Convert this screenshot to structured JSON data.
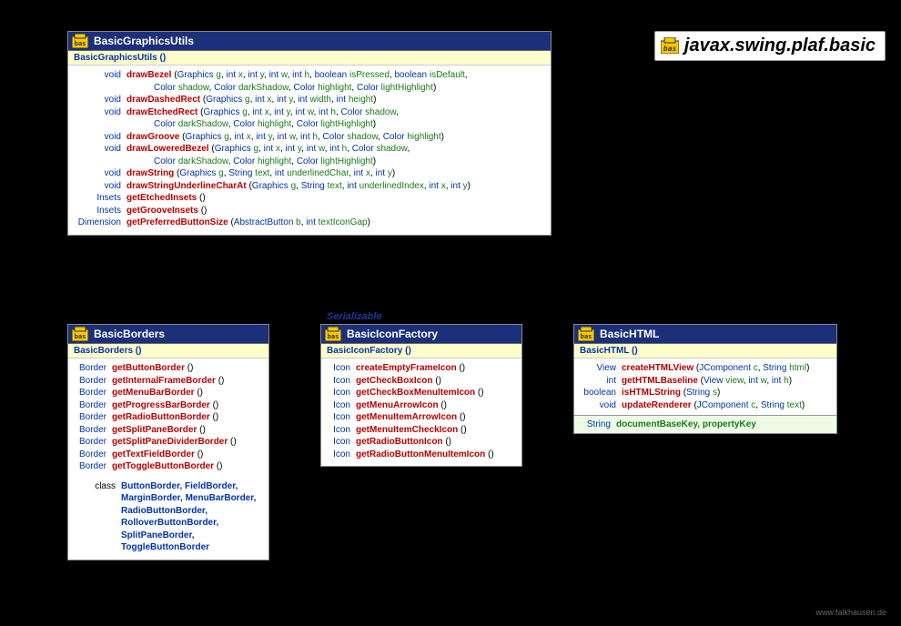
{
  "package_name": "javax.swing.plaf.basic",
  "footer": "www.falkhausen.de",
  "interface_label": "Serializable",
  "boxes": {
    "graphics": {
      "title": "BasicGraphicsUtils",
      "constructor": "BasicGraphicsUtils ()",
      "methods": [
        {
          "ret": "void",
          "name": "drawBezel",
          "sig": " (Graphics g, int x, int y, int w, int h, boolean isPressed, boolean isDefault,",
          "cont": "Color shadow, Color darkShadow, Color highlight, Color lightHighlight)"
        },
        {
          "ret": "void",
          "name": "drawDashedRect",
          "sig": " (Graphics g, int x, int y, int width, int height)"
        },
        {
          "ret": "void",
          "name": "drawEtchedRect",
          "sig": " (Graphics g, int x, int y, int w, int h, Color shadow,",
          "cont": "Color darkShadow, Color highlight, Color lightHighlight)"
        },
        {
          "ret": "void",
          "name": "drawGroove",
          "sig": " (Graphics g, int x, int y, int w, int h, Color shadow, Color highlight)"
        },
        {
          "ret": "void",
          "name": "drawLoweredBezel",
          "sig": " (Graphics g, int x, int y, int w, int h, Color shadow,",
          "cont": "Color darkShadow, Color highlight, Color lightHighlight)"
        },
        {
          "ret": "void",
          "name": "drawString",
          "sig": " (Graphics g, String text, int underlinedChar, int x, int y)"
        },
        {
          "ret": "void",
          "name": "drawStringUnderlineCharAt",
          "sig": " (Graphics g, String text, int underlinedIndex, int x, int y)"
        },
        {
          "ret": "Insets",
          "name": "getEtchedInsets",
          "sig": " ()"
        },
        {
          "ret": "Insets",
          "name": "getGrooveInsets",
          "sig": " ()"
        },
        {
          "ret": "Dimension",
          "name": "getPreferredButtonSize",
          "sig": " (AbstractButton b, int textIconGap)"
        }
      ]
    },
    "borders": {
      "title": "BasicBorders",
      "constructor": "BasicBorders ()",
      "methods": [
        {
          "ret": "Border",
          "name": "getButtonBorder",
          "sig": " ()"
        },
        {
          "ret": "Border",
          "name": "getInternalFrameBorder",
          "sig": " ()"
        },
        {
          "ret": "Border",
          "name": "getMenuBarBorder",
          "sig": " ()"
        },
        {
          "ret": "Border",
          "name": "getProgressBarBorder",
          "sig": " ()"
        },
        {
          "ret": "Border",
          "name": "getRadioButtonBorder",
          "sig": " ()"
        },
        {
          "ret": "Border",
          "name": "getSplitPaneBorder",
          "sig": " ()"
        },
        {
          "ret": "Border",
          "name": "getSplitPaneDividerBorder",
          "sig": " ()"
        },
        {
          "ret": "Border",
          "name": "getTextFieldBorder",
          "sig": " ()"
        },
        {
          "ret": "Border",
          "name": "getToggleButtonBorder",
          "sig": " ()"
        }
      ],
      "nested_label": "class",
      "nested": "ButtonBorder, FieldBorder, MarginBorder, MenuBarBorder, RadioButtonBorder, RolloverButtonBorder, SplitPaneBorder, ToggleButtonBorder"
    },
    "iconfactory": {
      "title": "BasicIconFactory",
      "constructor": "BasicIconFactory ()",
      "methods": [
        {
          "ret": "Icon",
          "name": "createEmptyFrameIcon",
          "sig": " ()"
        },
        {
          "ret": "Icon",
          "name": "getCheckBoxIcon",
          "sig": " ()"
        },
        {
          "ret": "Icon",
          "name": "getCheckBoxMenuItemIcon",
          "sig": " ()"
        },
        {
          "ret": "Icon",
          "name": "getMenuArrowIcon",
          "sig": " ()"
        },
        {
          "ret": "Icon",
          "name": "getMenuItemArrowIcon",
          "sig": " ()"
        },
        {
          "ret": "Icon",
          "name": "getMenuItemCheckIcon",
          "sig": " ()"
        },
        {
          "ret": "Icon",
          "name": "getRadioButtonIcon",
          "sig": " ()"
        },
        {
          "ret": "Icon",
          "name": "getRadioButtonMenuItemIcon",
          "sig": " ()"
        }
      ]
    },
    "html": {
      "title": "BasicHTML",
      "constructor": "BasicHTML ()",
      "methods": [
        {
          "ret": "View",
          "name": "createHTMLView",
          "sig": " (JComponent c, String html)"
        },
        {
          "ret": "int",
          "name": "getHTMLBaseline",
          "sig": " (View view, int w, int h)"
        },
        {
          "ret": "boolean",
          "name": "isHTMLString",
          "sig": " (String s)"
        },
        {
          "ret": "void",
          "name": "updateRenderer",
          "sig": " (JComponent c, String text)"
        }
      ],
      "fields_ret": "String",
      "fields": "documentBaseKey, propertyKey"
    }
  }
}
